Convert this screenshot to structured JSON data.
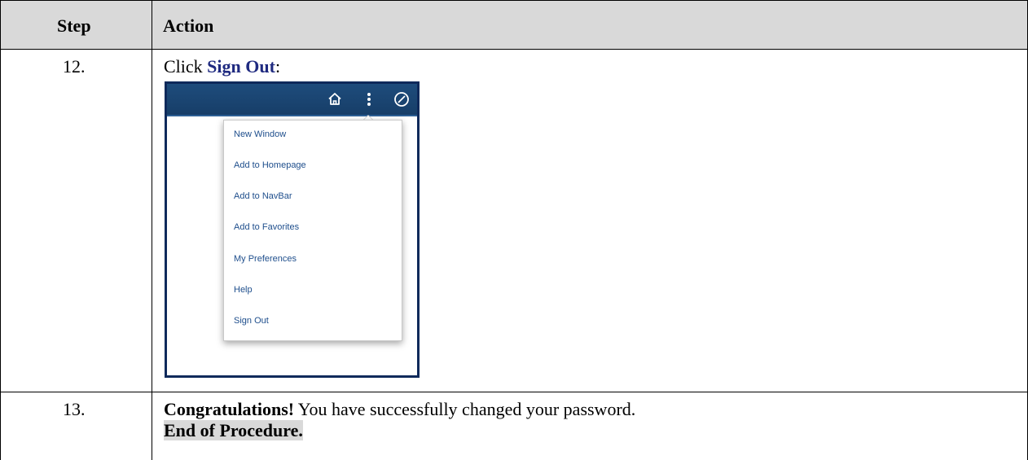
{
  "table": {
    "header": {
      "step": "Step",
      "action": "Action"
    },
    "rows": [
      {
        "step": "12.",
        "instruction_prefix": "Click ",
        "instruction_link": "Sign Out",
        "instruction_suffix": ":"
      },
      {
        "step": "13.",
        "congrats": "Congratulations!",
        "message": " You have successfully changed your password.",
        "end": "End of Procedure."
      }
    ]
  },
  "screenshot": {
    "toolbar_icons": [
      "home-icon",
      "more-vertical-icon",
      "compass-icon"
    ],
    "menu_items": [
      "New Window",
      "Add to Homepage",
      "Add to NavBar",
      "Add to Favorites",
      "My Preferences",
      "Help",
      "Sign Out"
    ]
  },
  "colors": {
    "header_bg": "#d9d9d9",
    "link": "#1f2a80",
    "toolbar": "#1e4c7c",
    "menu_text": "#1e4e8c"
  }
}
